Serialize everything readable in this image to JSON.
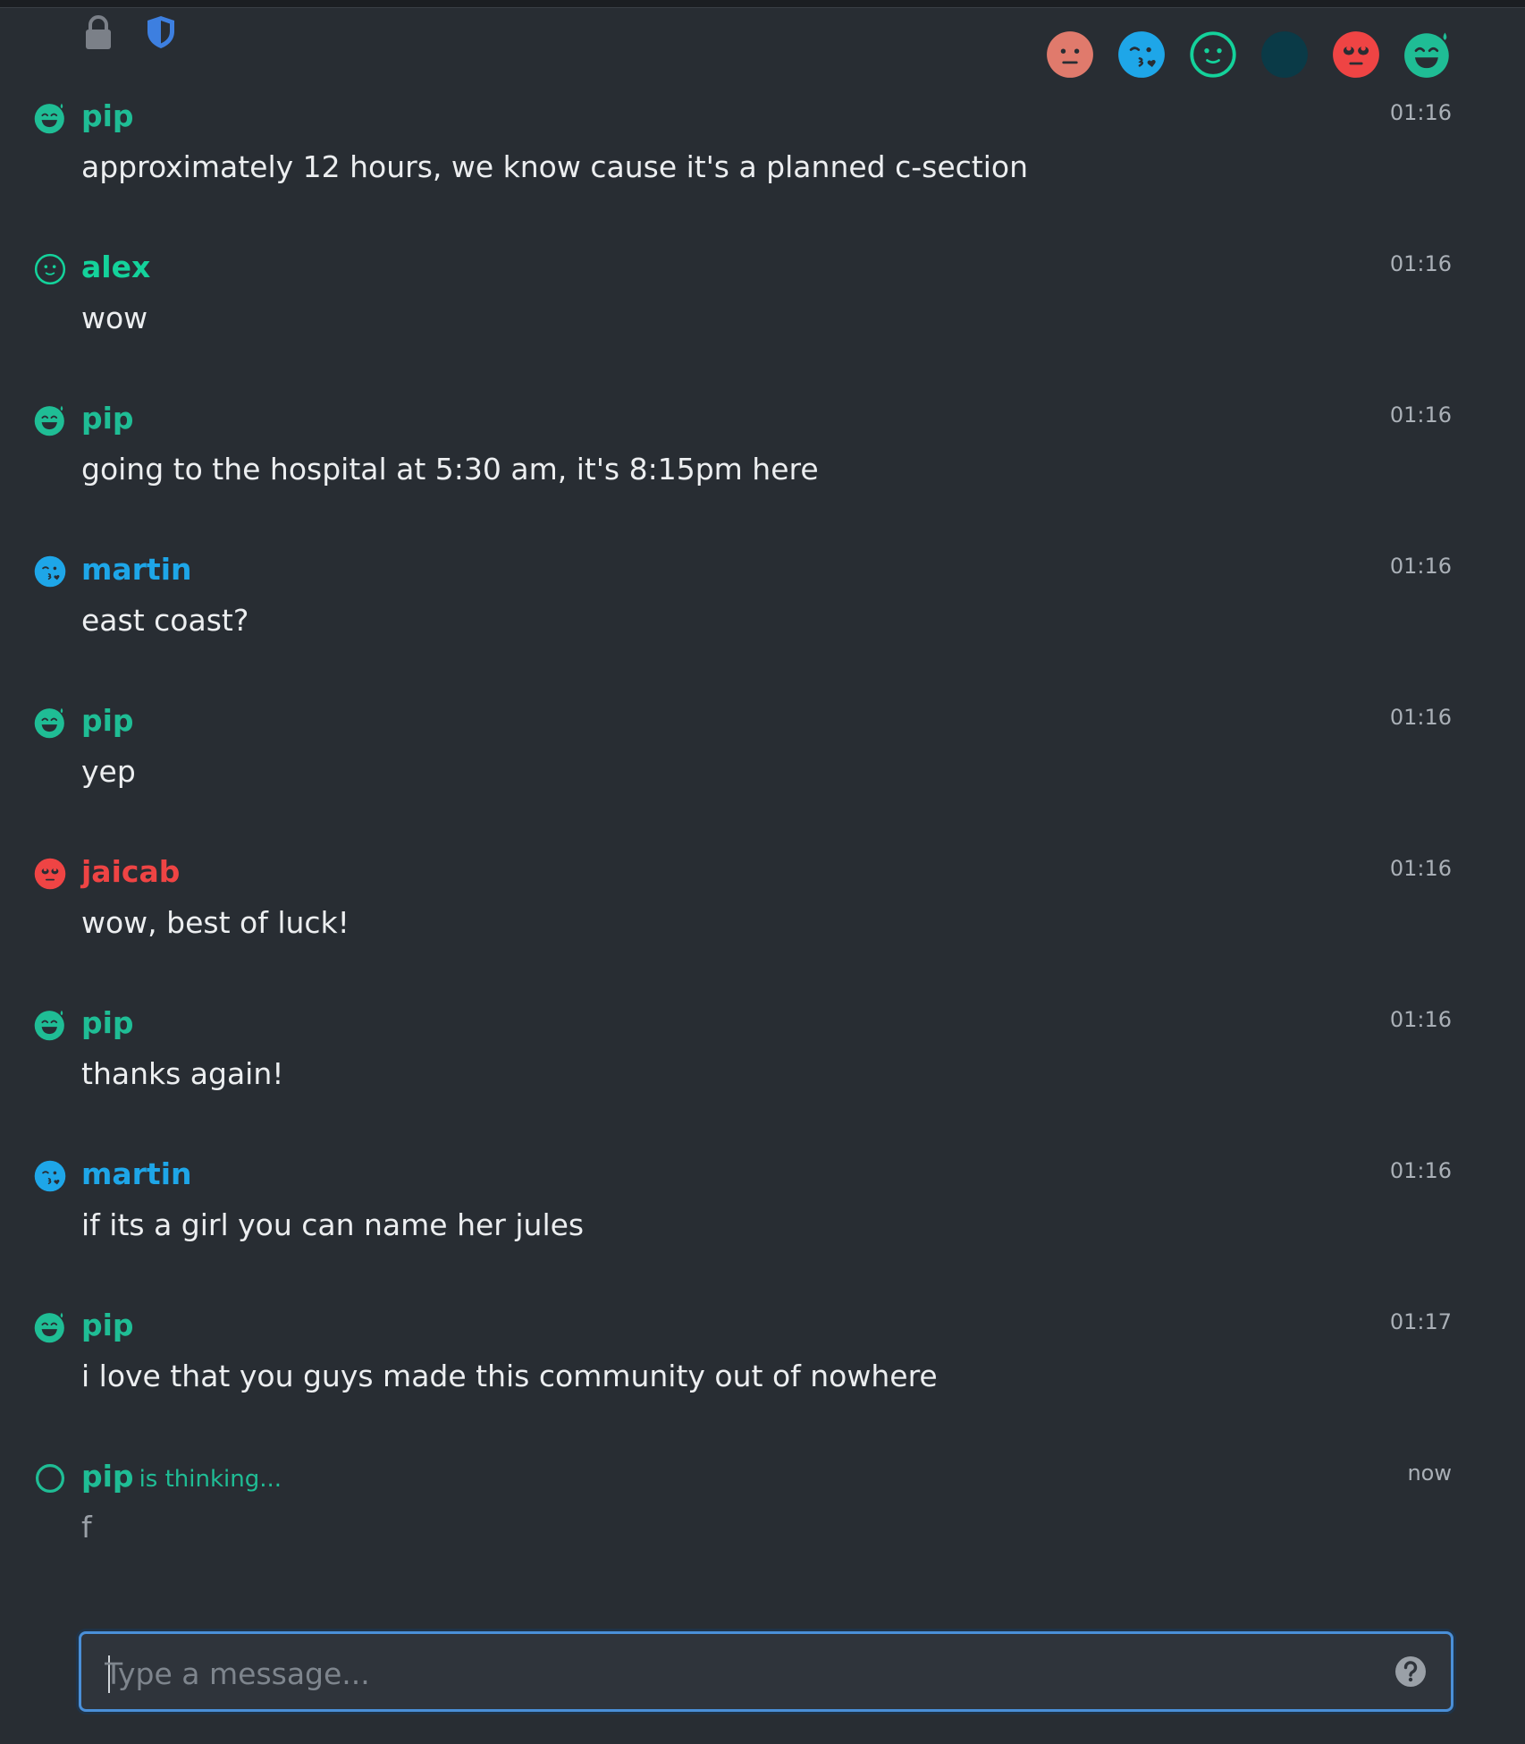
{
  "header": {
    "lock_icon": "lock-icon",
    "shield_icon": "shield-icon",
    "presence": [
      {
        "icon": "neutral-face-icon",
        "color": "#e07a6c"
      },
      {
        "icon": "kissing-face-icon",
        "color": "#1ea6e8"
      },
      {
        "icon": "open-face-icon",
        "color": "#14d29b"
      },
      {
        "icon": "dark-circle-icon",
        "color": "#0a3a47"
      },
      {
        "icon": "rolling-eyes-face-icon",
        "color": "#ef4444"
      },
      {
        "icon": "sweat-smile-face-icon",
        "color": "#1fbd95"
      }
    ]
  },
  "users": {
    "pip": {
      "color": "#1fbd95",
      "icon": "sweat-smile-face-icon"
    },
    "alex": {
      "color": "#14d29b",
      "icon": "open-face-icon"
    },
    "martin": {
      "color": "#1ea6e8",
      "icon": "kissing-face-icon"
    },
    "jaicab": {
      "color": "#ef4444",
      "icon": "rolling-eyes-face-icon"
    }
  },
  "messages": [
    {
      "author": "pip",
      "time": "01:16",
      "text": "approximately 12 hours, we know cause it's a planned c-section"
    },
    {
      "author": "alex",
      "time": "01:16",
      "text": "wow"
    },
    {
      "author": "pip",
      "time": "01:16",
      "text": "going to the hospital at 5:30 am, it's 8:15pm here"
    },
    {
      "author": "martin",
      "time": "01:16",
      "text": "east coast?"
    },
    {
      "author": "pip",
      "time": "01:16",
      "text": "yep"
    },
    {
      "author": "jaicab",
      "time": "01:16",
      "text": "wow, best of luck!"
    },
    {
      "author": "pip",
      "time": "01:16",
      "text": "thanks again!"
    },
    {
      "author": "martin",
      "time": "01:16",
      "text": "if its a girl you can name her jules"
    },
    {
      "author": "pip",
      "time": "01:17",
      "text": "i love that you guys made this community out of nowhere"
    }
  ],
  "typing": {
    "author": "pip",
    "status": "is thinking...",
    "time": "now",
    "text": "f"
  },
  "composer": {
    "placeholder": "Type a message...",
    "value": "",
    "help_icon": "help-icon"
  }
}
